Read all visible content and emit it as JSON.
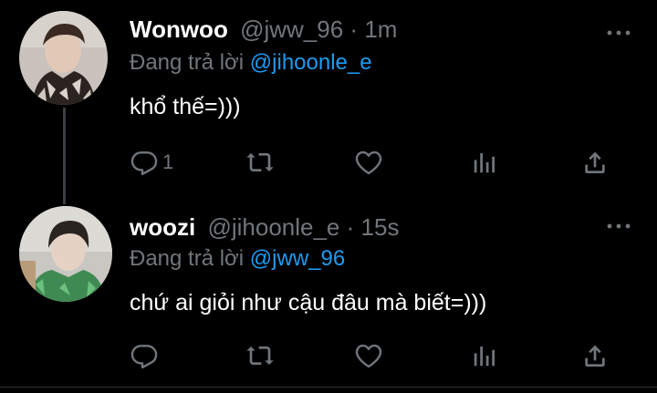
{
  "theme": {
    "background": "#000000",
    "text_primary": "#ffffff",
    "text_secondary": "#71767b",
    "accent": "#1d9bf0",
    "thread_line": "#3a3f44"
  },
  "tweets": [
    {
      "display_name": "Wonwoo",
      "handle": "@jww_96",
      "separator": "·",
      "time": "1m",
      "reply_prefix": "Đang trả lời",
      "reply_to": "@jihoonle_e",
      "text": "khổ thế=)))",
      "reply_count": "1",
      "icons": [
        "reply-icon",
        "retweet-icon",
        "like-icon",
        "analytics-icon",
        "share-icon"
      ]
    },
    {
      "display_name": "woozi",
      "handle": "@jihoonle_e",
      "separator": "·",
      "time": "15s",
      "reply_prefix": "Đang trả lời",
      "reply_to": "@jww_96",
      "text": "chứ ai giỏi như cậu đâu mà biết=)))",
      "reply_count": "",
      "icons": [
        "reply-icon",
        "retweet-icon",
        "like-icon",
        "analytics-icon",
        "share-icon"
      ]
    }
  ]
}
